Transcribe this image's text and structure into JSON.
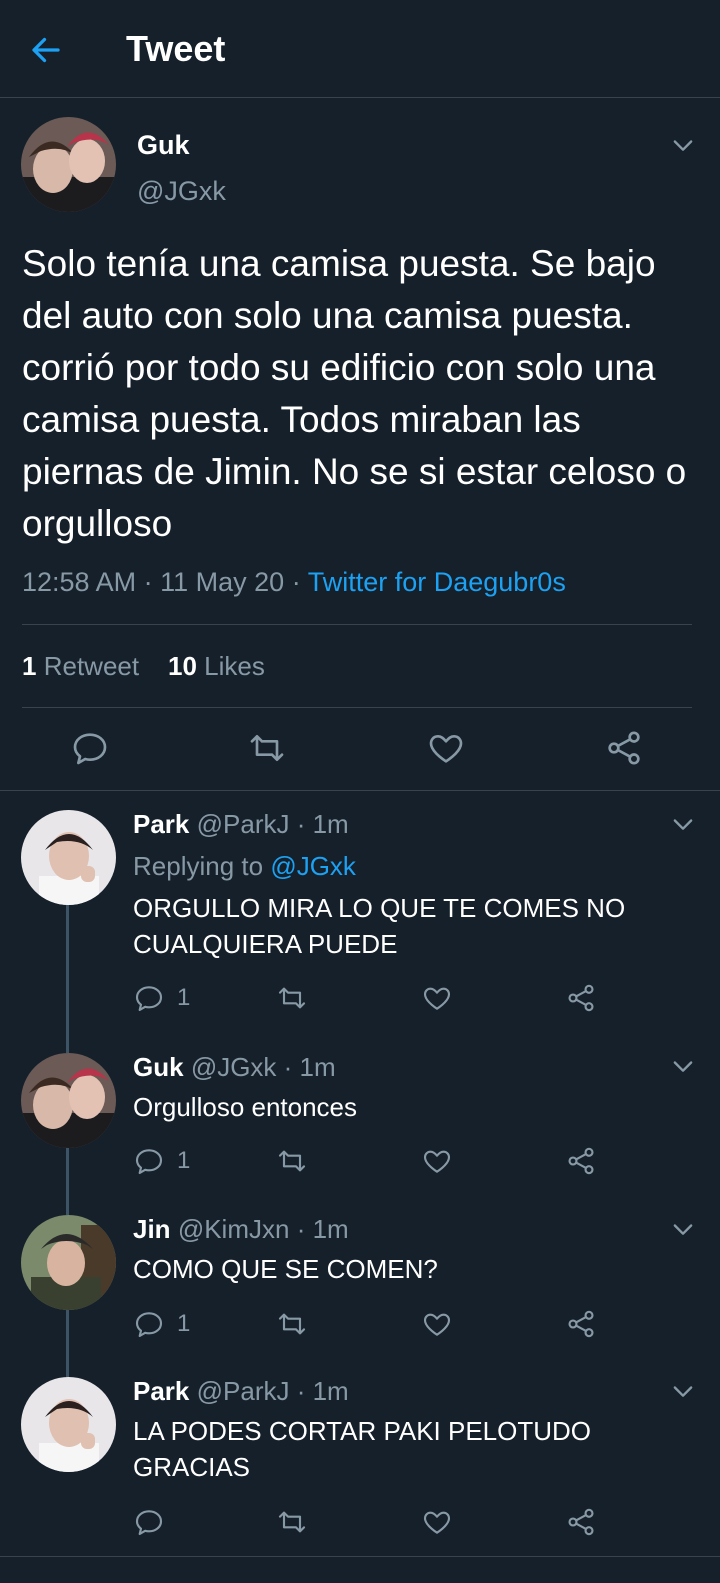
{
  "header": {
    "title": "Tweet",
    "back_icon": "back-arrow-icon"
  },
  "main_tweet": {
    "author_name": "Guk",
    "author_handle": "@JGxk",
    "text": "Solo tenía una camisa puesta. Se bajo del auto con solo una camisa puesta. corrió por todo su edificio con solo una camisa puesta. Todos miraban las piernas de Jimin. No se si estar celoso o orgulloso",
    "time": "12:58 AM",
    "date": "11 May 20",
    "separator": "·",
    "source": "Twitter for Daegubr0s",
    "retweet_count": "1",
    "retweet_label": "Retweet",
    "like_count": "10",
    "like_label": "Likes"
  },
  "replies": [
    {
      "name": "Park",
      "handle": "@ParkJ",
      "time": "· 1m",
      "replying_label": "Replying to",
      "replying_to": "@JGxk",
      "text": "ORGULLO MIRA LO QUE TE COMES NO CUALQUIERA PUEDE",
      "reply_count": "1"
    },
    {
      "name": "Guk",
      "handle": "@JGxk",
      "time": "· 1m",
      "text": "Orgulloso entonces",
      "reply_count": "1"
    },
    {
      "name": "Jin",
      "handle": "@KimJxn",
      "time": "· 1m",
      "text": "COMO QUE SE COMEN?",
      "reply_count": "1"
    },
    {
      "name": "Park",
      "handle": "@ParkJ",
      "time": "· 1m",
      "text": "LA PODES CORTAR PAKI PELOTUDO GRACIAS",
      "reply_count": ""
    }
  ],
  "colors": {
    "background": "#15202b",
    "accent": "#1da1f2",
    "secondary_text": "#8899a6",
    "divider": "#38444d"
  },
  "icons": [
    "back-arrow-icon",
    "chevron-down-icon",
    "reply-icon",
    "retweet-icon",
    "like-icon",
    "share-icon"
  ]
}
